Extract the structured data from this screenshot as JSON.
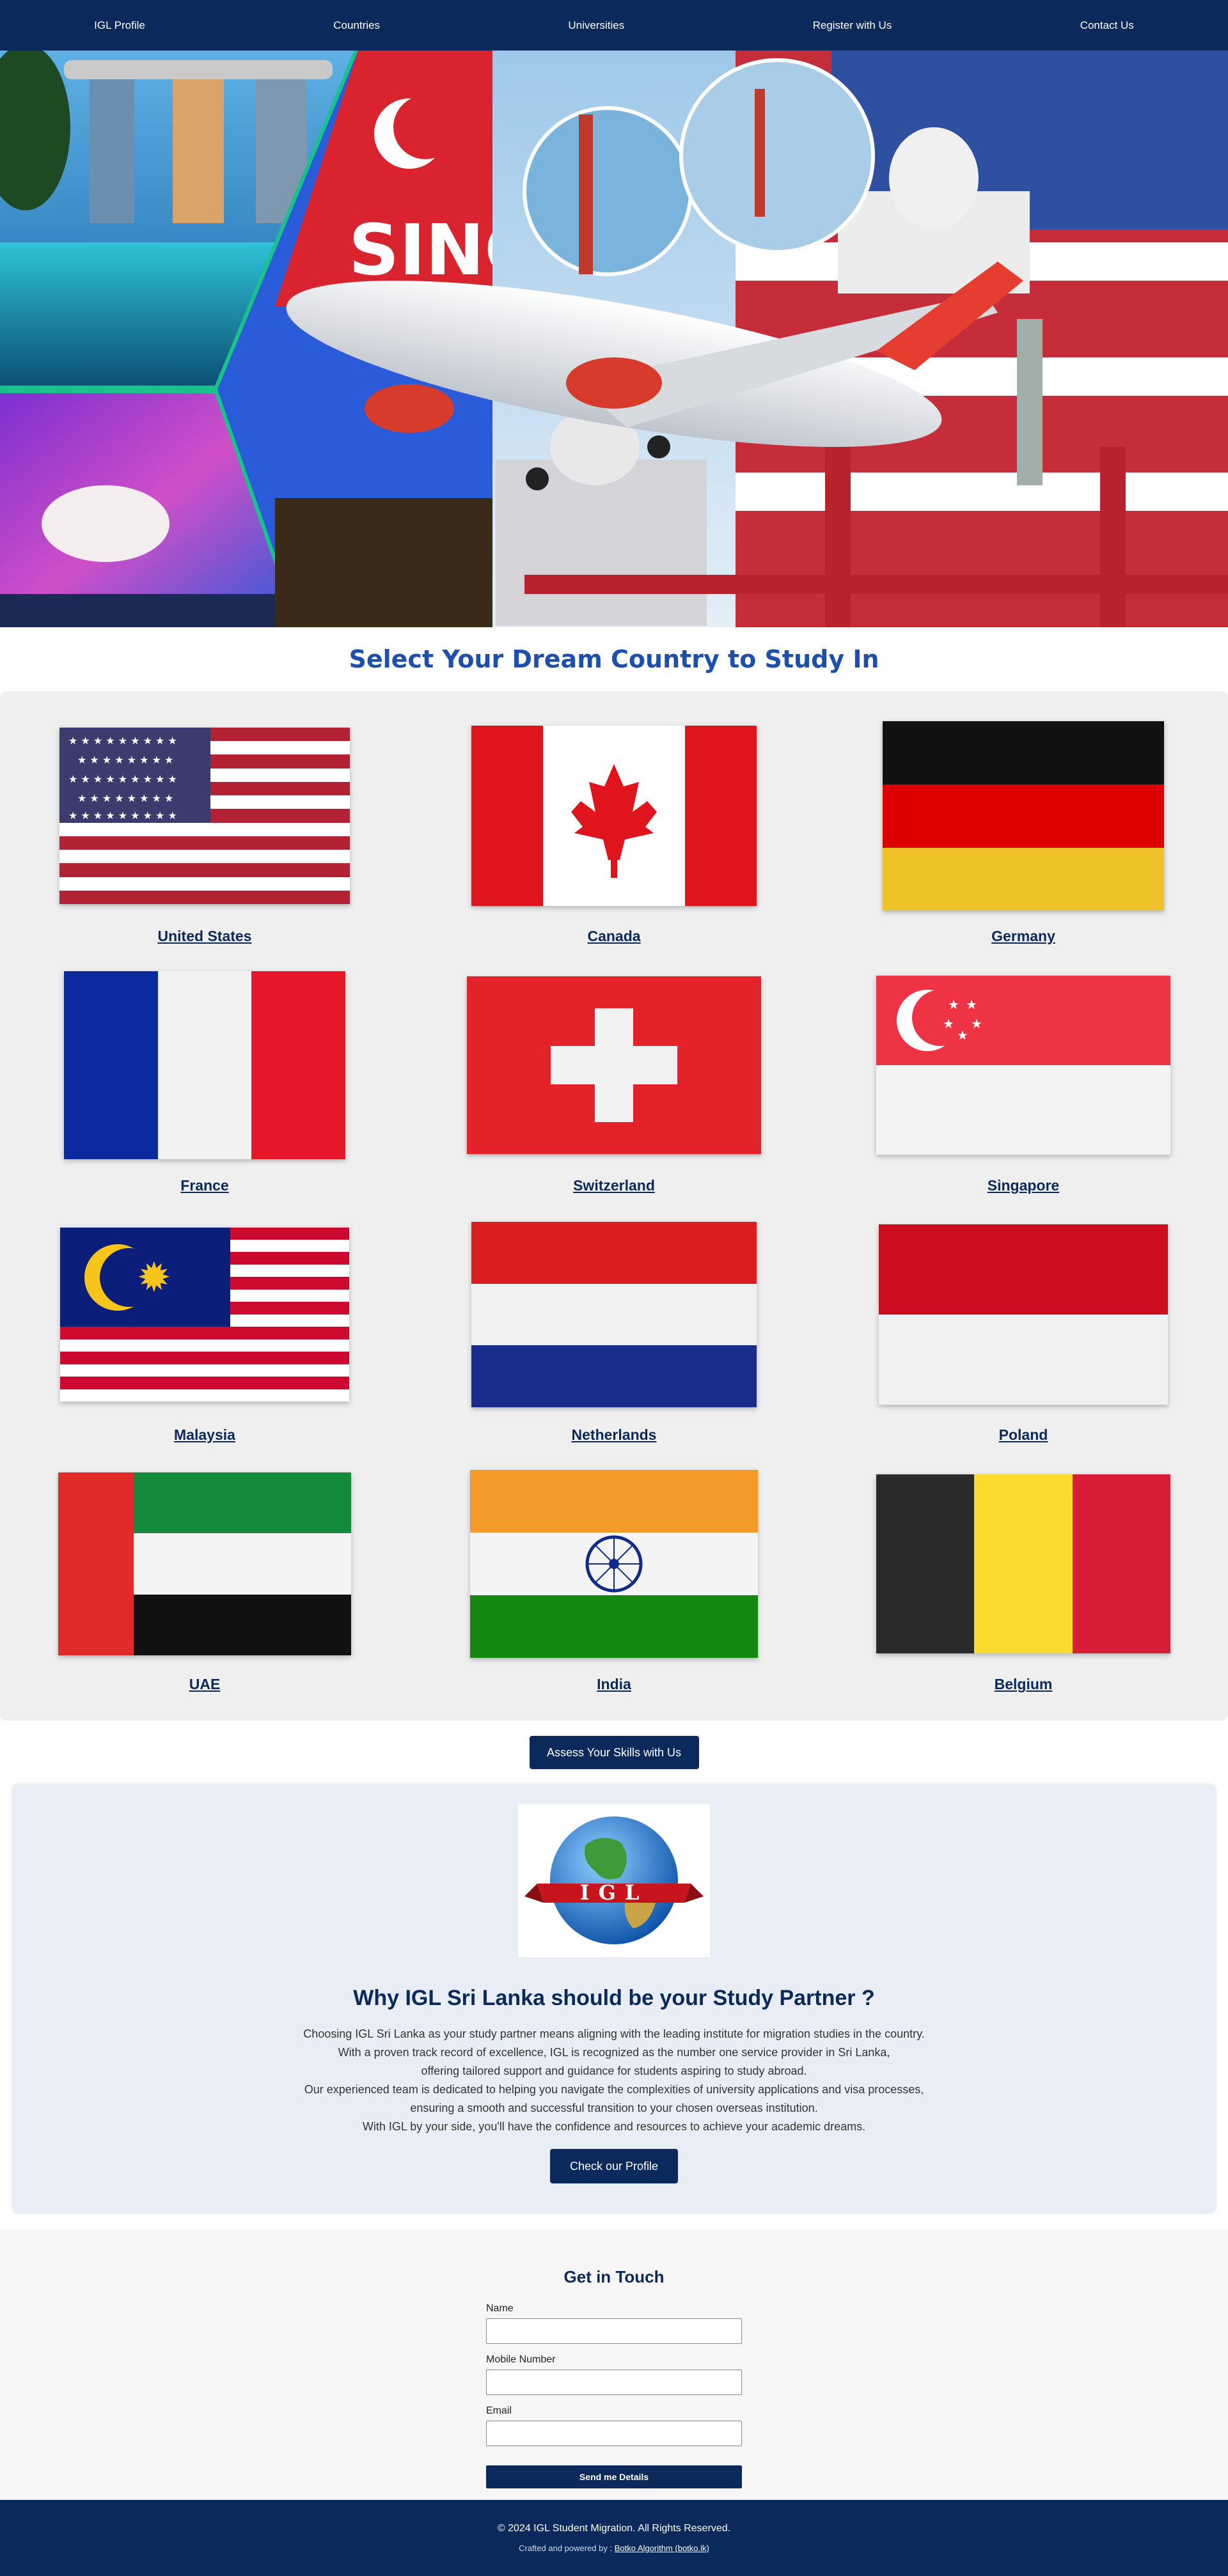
{
  "nav": {
    "items": [
      "IGL Profile",
      "Countries",
      "Universities",
      "Register with Us",
      "Contact Us"
    ]
  },
  "hero": {
    "banner_text": "SING"
  },
  "countries_section": {
    "title": "Select Your Dream Country to Study In",
    "countries": [
      "United States",
      "Canada",
      "Germany",
      "France",
      "Switzerland",
      "Singapore",
      "Malaysia",
      "Netherlands",
      "Poland",
      "UAE",
      "India",
      "Belgium"
    ]
  },
  "assess": {
    "label": "Assess Your Skills with Us"
  },
  "why": {
    "logo_text": "IGL",
    "title": "Why IGL Sri Lanka should be your Study Partner ?",
    "lines": [
      "Choosing IGL Sri Lanka as your study partner means aligning with the leading institute for migration studies in the country.",
      "With a proven track record of excellence, IGL is recognized as the number one service provider in Sri Lanka,",
      "offering tailored support and guidance for students aspiring to study abroad.",
      "Our experienced team is dedicated to helping you navigate the complexities of university applications and visa processes,",
      "ensuring a smooth and successful transition to your chosen overseas institution.",
      "With IGL by your side, you'll have the confidence and resources to achieve your academic dreams."
    ],
    "button": "Check our Profile"
  },
  "contact": {
    "title": "Get in Touch",
    "name_label": "Name",
    "mobile_label": "Mobile Number",
    "email_label": "Email",
    "button": "Send me Details"
  },
  "footer": {
    "copyright": "© 2024 IGL Student Migration. All Rights Reserved.",
    "credit_prefix": "Crafted and powered by :",
    "credit_link": "Botko Algorithm (botko.lk)"
  },
  "colors": {
    "primary": "#0b2a5b",
    "title_blue": "#1d4fae",
    "section_bg": "#efefef",
    "why_bg": "#e9eef6"
  }
}
